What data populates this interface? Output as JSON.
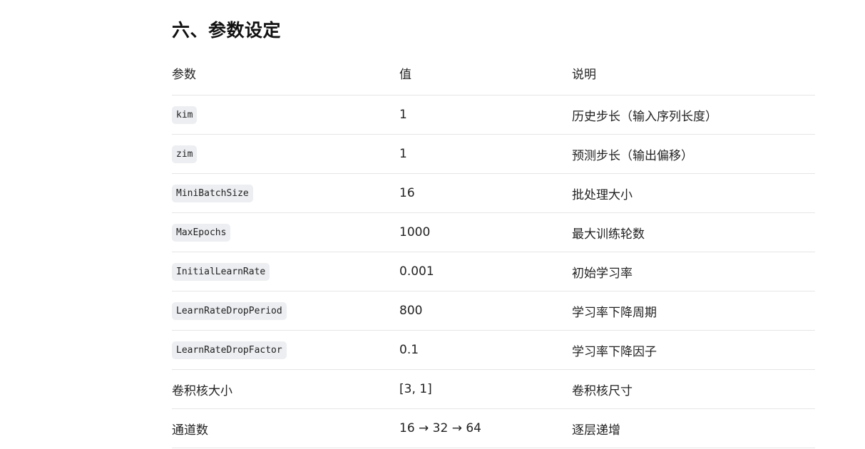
{
  "section": {
    "title": "六、参数设定"
  },
  "table": {
    "headers": [
      "参数",
      "值",
      "说明"
    ],
    "rows": [
      {
        "param": "kim",
        "param_is_code": true,
        "value": "1",
        "desc": "历史步长（输入序列长度）"
      },
      {
        "param": "zim",
        "param_is_code": true,
        "value": "1",
        "desc": "预测步长（输出偏移）"
      },
      {
        "param": "MiniBatchSize",
        "param_is_code": true,
        "value": "16",
        "desc": "批处理大小"
      },
      {
        "param": "MaxEpochs",
        "param_is_code": true,
        "value": "1000",
        "desc": "最大训练轮数"
      },
      {
        "param": "InitialLearnRate",
        "param_is_code": true,
        "value": "0.001",
        "desc": "初始学习率"
      },
      {
        "param": "LearnRateDropPeriod",
        "param_is_code": true,
        "value": "800",
        "desc": "学习率下降周期"
      },
      {
        "param": "LearnRateDropFactor",
        "param_is_code": true,
        "value": "0.1",
        "desc": "学习率下降因子"
      },
      {
        "param": "卷积核大小",
        "param_is_code": false,
        "value": "[3, 1]",
        "desc": "卷积核尺寸"
      },
      {
        "param": "通道数",
        "param_is_code": false,
        "value": "16 → 32 → 64",
        "desc": "逐层递增"
      }
    ]
  }
}
